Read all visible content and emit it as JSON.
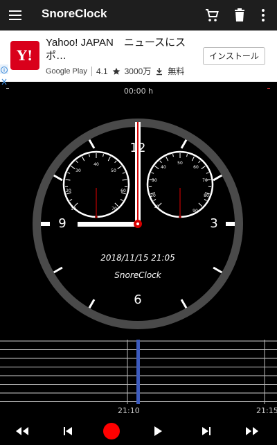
{
  "appbar": {
    "title": "SnoreClock",
    "icons": [
      "menu-icon",
      "cart-icon",
      "trash-icon",
      "more-vert-icon"
    ]
  },
  "ad": {
    "logo_text": "Y!",
    "title": "Yahoo! JAPAN　ニュースにスポ…",
    "store": "Google Play",
    "rating": "4.1",
    "downloads": "3000万",
    "price": "無料",
    "install_label": "インストール"
  },
  "duration": "00:00 h",
  "clock": {
    "numerals": [
      "12",
      "3",
      "6",
      "9"
    ],
    "datetime": "2018/11/15 21:05",
    "brand": "SnoreClock",
    "left_dial_ticks": [
      "10",
      "20",
      "30",
      "40",
      "50",
      "60",
      "70"
    ],
    "right_dial_ticks": [
      "10",
      "20",
      "30",
      "40",
      "50",
      "60",
      "70",
      "80",
      "90"
    ],
    "colors": {
      "bezel": "#4a4a4a",
      "hand": "#d40000",
      "needle": "#9c0000"
    }
  },
  "timeline": {
    "labels": [
      "21:10",
      "21:15"
    ]
  },
  "controls": [
    "rewind-icon",
    "skip-previous-icon",
    "record-icon",
    "play-icon",
    "skip-next-icon",
    "fast-forward-icon"
  ]
}
